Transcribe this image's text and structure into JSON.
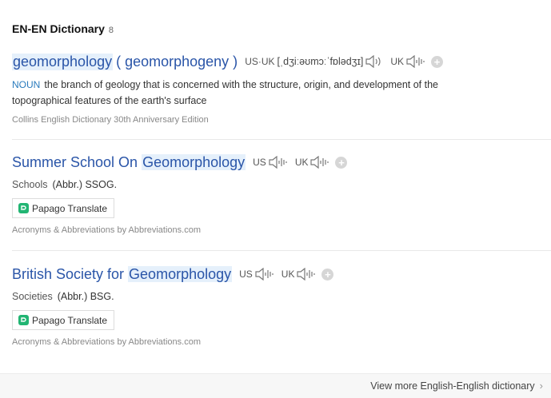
{
  "header": {
    "title": "EN-EN Dictionary",
    "count": "8"
  },
  "entries": [
    {
      "word": "geomorphology",
      "alt": "( geomorphogeny )",
      "pron_label_1": "US·UK",
      "phonetic": "[ˌdʒiːəʊmɔːˈfɒlədʒɪ]",
      "pron_label_2": "UK",
      "pos": "NOUN",
      "definition": "the branch of geology that is concerned with the structure, origin, and development of the topographical features of the earth's surface",
      "source": "Collins English Dictionary 30th Anniversary Edition"
    },
    {
      "word_prefix": "Summer School On ",
      "word_hl": "Geomorphology",
      "pron_label_1": "US",
      "pron_label_2": "UK",
      "category": "Schools",
      "abbr": "(Abbr.) SSOG.",
      "translate": "Papago Translate",
      "source": "Acronyms & Abbreviations by Abbreviations.com"
    },
    {
      "word_prefix": "British Society for ",
      "word_hl": "Geomorphology",
      "pron_label_1": "US",
      "pron_label_2": "UK",
      "category": "Societies",
      "abbr": "(Abbr.) BSG.",
      "translate": "Papago Translate",
      "source": "Acronyms & Abbreviations by Abbreviations.com"
    }
  ],
  "footer": {
    "more": "View more English-English dictionary"
  },
  "colors": {
    "link": "#2a55a8",
    "highlight": "#e5f0fb",
    "pos": "#2a7bbd",
    "papago": "#22b573"
  }
}
